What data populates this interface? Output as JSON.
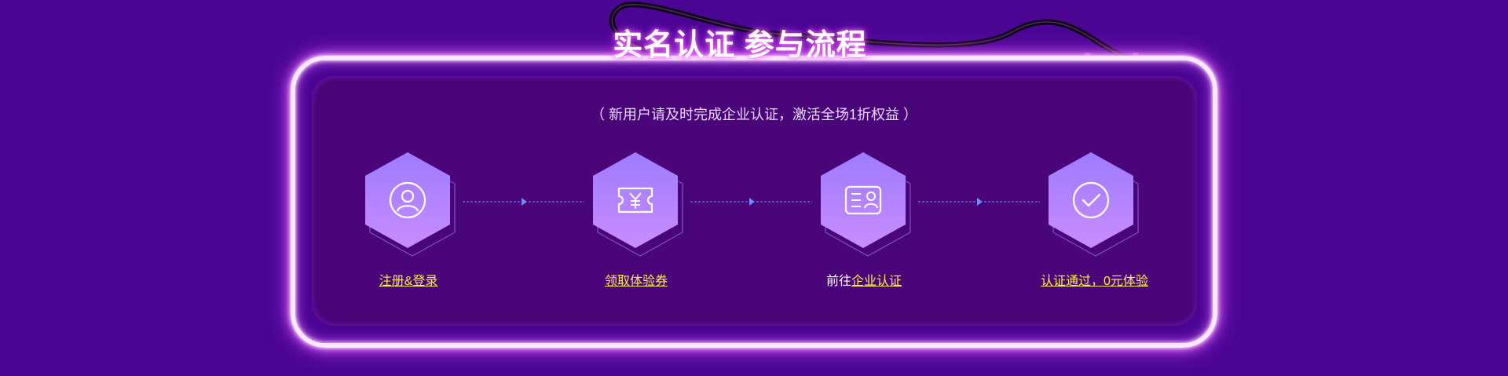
{
  "title": "实名认证 参与流程",
  "subtitle": "（ 新用户请及时完成企业认证，激活全场1折权益 ）",
  "steps": [
    {
      "icon": "user-icon",
      "prefix": "",
      "link": "注册&登录"
    },
    {
      "icon": "coupon-icon",
      "prefix": "",
      "link": "领取体验券"
    },
    {
      "icon": "id-card-icon",
      "prefix": "前往",
      "link": "企业认证"
    },
    {
      "icon": "check-circle-icon",
      "prefix": "",
      "link": "认证通过，0元体验"
    }
  ],
  "colors": {
    "background": "#4a0593",
    "panel": "#4a0579",
    "neon": "#fbe7ff",
    "link": "#ffea4f",
    "hex_top": "#9d7bff",
    "hex_bottom": "#c98cff",
    "connector": "#6f8cff"
  }
}
